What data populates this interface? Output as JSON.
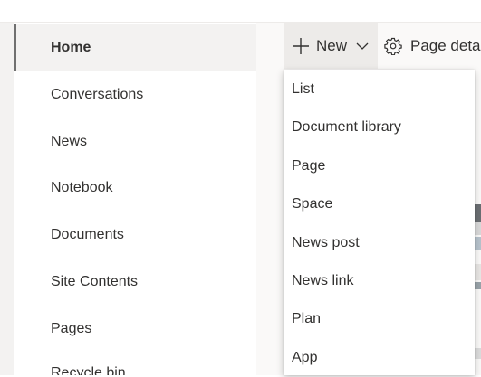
{
  "nav": {
    "items": [
      {
        "label": "Home",
        "selected": true
      },
      {
        "label": "Conversations"
      },
      {
        "label": "News"
      },
      {
        "label": "Notebook"
      },
      {
        "label": "Documents"
      },
      {
        "label": "Site Contents"
      },
      {
        "label": "Pages"
      },
      {
        "label": "Recycle bin"
      }
    ]
  },
  "command_bar": {
    "new_label": "New",
    "page_details_label": "Page detai"
  },
  "new_menu": {
    "items": [
      "List",
      "Document library",
      "Page",
      "Space",
      "News post",
      "News link",
      "Plan",
      "App"
    ]
  },
  "colors": {
    "selected_bg": "#f3f2f1",
    "selected_border": "#707070",
    "text": "#323130",
    "content_bg": "#faf9f8",
    "new_button_bg": "#edebe9"
  },
  "icons": {
    "new": "plus-icon",
    "new_dropdown": "chevron-down-icon",
    "page_details": "gear-icon"
  }
}
